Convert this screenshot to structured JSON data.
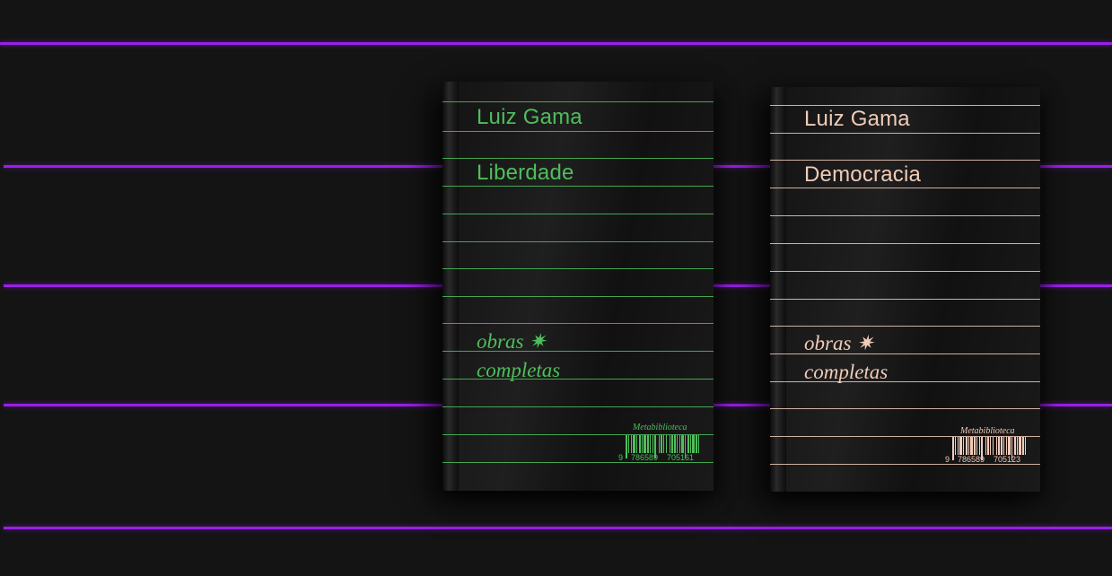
{
  "palette": {
    "background": "#141414",
    "accent_line": "#9a1fe8"
  },
  "books": [
    {
      "author": "Luiz Gama",
      "title": "Liberdade",
      "series_line1": "obras",
      "series_line2": "completas",
      "star_glyph": "✷",
      "publisher": "Metabiblioteca",
      "isbn_lead": "9",
      "isbn_group1": "786589",
      "isbn_group2": "705161",
      "color": "#4fbe5c"
    },
    {
      "author": "Luiz Gama",
      "title": "Democracia",
      "series_line1": "obras",
      "series_line2": "completas",
      "star_glyph": "✷",
      "publisher": "Metabiblioteca",
      "isbn_lead": "9",
      "isbn_group1": "786589",
      "isbn_group2": "705123",
      "color": "#f1cbb8"
    }
  ]
}
